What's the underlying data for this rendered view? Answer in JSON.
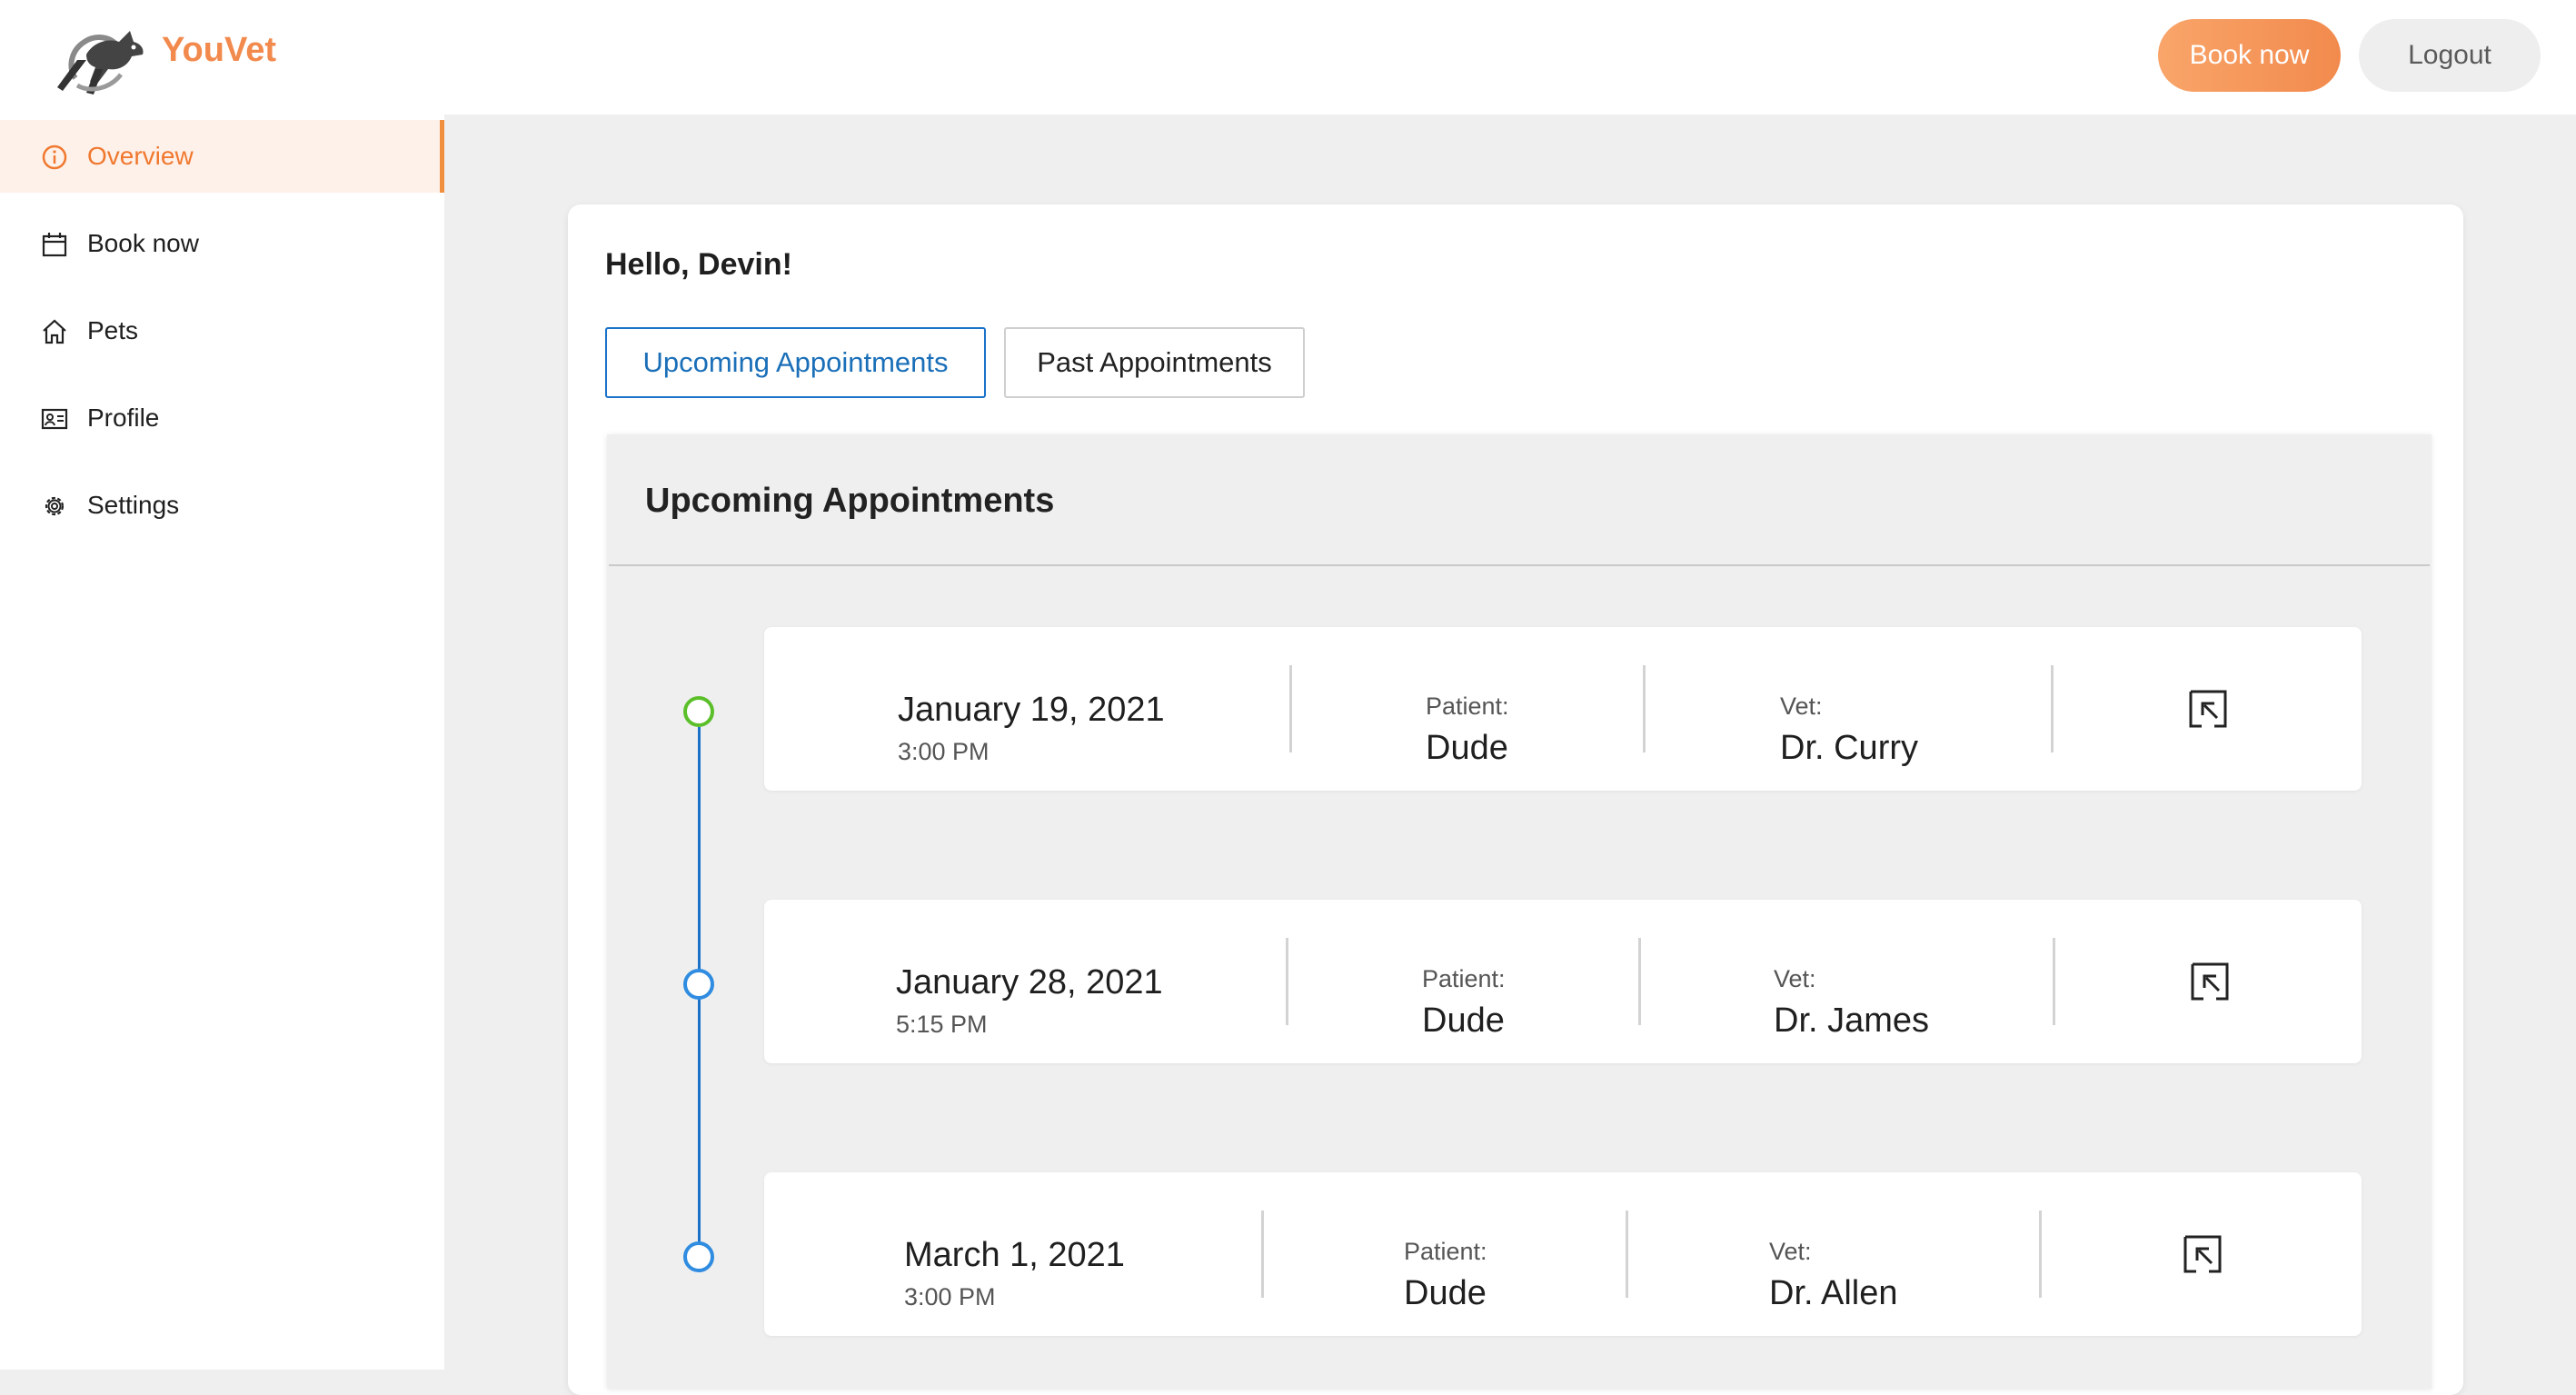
{
  "header": {
    "brand": "YouVet",
    "book_now_label": "Book now",
    "logout_label": "Logout",
    "brand_color": "#f28a4d"
  },
  "sidebar": {
    "items": [
      {
        "label": "Overview",
        "icon": "info-icon",
        "active": true
      },
      {
        "label": "Book now",
        "icon": "calendar-icon",
        "active": false
      },
      {
        "label": "Pets",
        "icon": "home-icon",
        "active": false
      },
      {
        "label": "Profile",
        "icon": "id-card-icon",
        "active": false
      },
      {
        "label": "Settings",
        "icon": "gear-icon",
        "active": false
      }
    ]
  },
  "main": {
    "greeting": "Hello, Devin!",
    "tabs": [
      {
        "label": "Upcoming Appointments",
        "selected": true
      },
      {
        "label": "Past Appointments",
        "selected": false
      }
    ],
    "panel_title": "Upcoming Appointments",
    "patient_label": "Patient:",
    "vet_label": "Vet:",
    "appointments": [
      {
        "date": "January 19, 2021",
        "time": "3:00 PM",
        "patient": "Dude",
        "vet": "Dr. Curry",
        "status_color": "#5bbf2a"
      },
      {
        "date": "January 28, 2021",
        "time": "5:15 PM",
        "patient": "Dude",
        "vet": "Dr. James",
        "status_color": "#2f8ce0"
      },
      {
        "date": "March 1, 2021",
        "time": "3:00 PM",
        "patient": "Dude",
        "vet": "Dr. Allen",
        "status_color": "#2f8ce0"
      }
    ]
  },
  "colors": {
    "accent": "#f0782e",
    "primary_blue": "#1a73c9",
    "background": "#efefef"
  }
}
